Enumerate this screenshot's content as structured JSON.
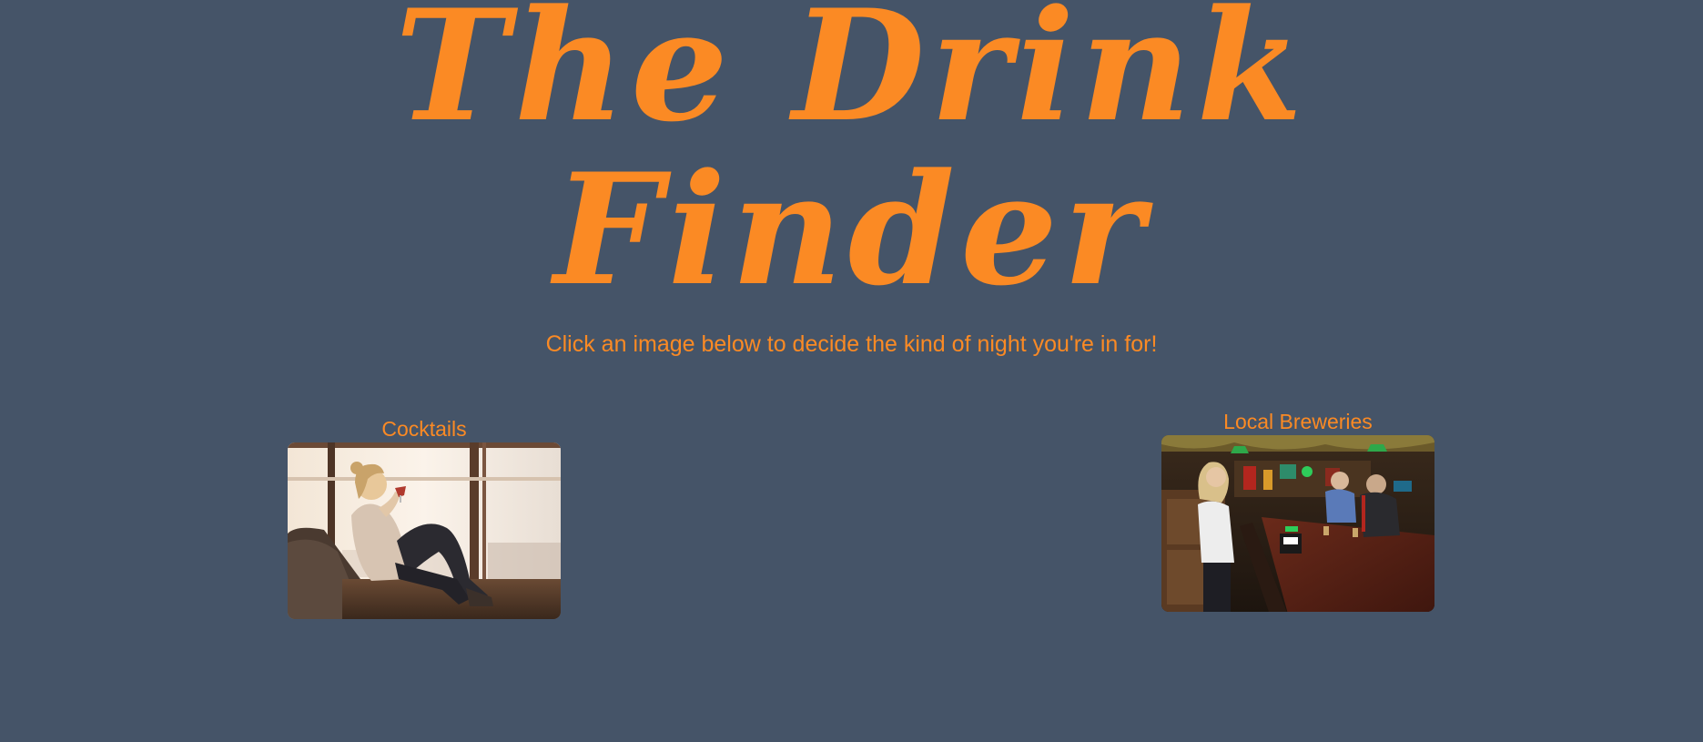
{
  "page": {
    "title_line_1": "The Drink",
    "title_line_2": "Finder",
    "subtitle": "Click an image below to decide the kind of night you're in for!"
  },
  "cards": [
    {
      "label": "Cocktails",
      "image_alt": "Woman sipping wine on a couch by a sunny window"
    },
    {
      "label": "Local Breweries",
      "image_alt": "Three people talking at a bar counter"
    }
  ],
  "colors": {
    "background": "#455468",
    "accent": "#fb8a24"
  }
}
